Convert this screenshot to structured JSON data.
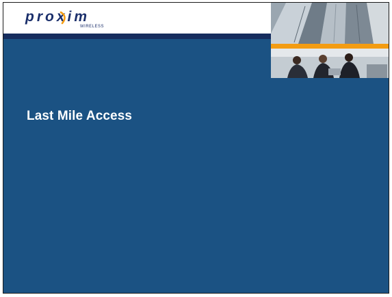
{
  "brand": {
    "name": "proxim",
    "tagline": "WIRELESS"
  },
  "slide": {
    "title": "Last Mile Access"
  },
  "colors": {
    "background": "#1b5283",
    "header_stripe": "#162d5e",
    "accent_orange": "#f39c12"
  }
}
